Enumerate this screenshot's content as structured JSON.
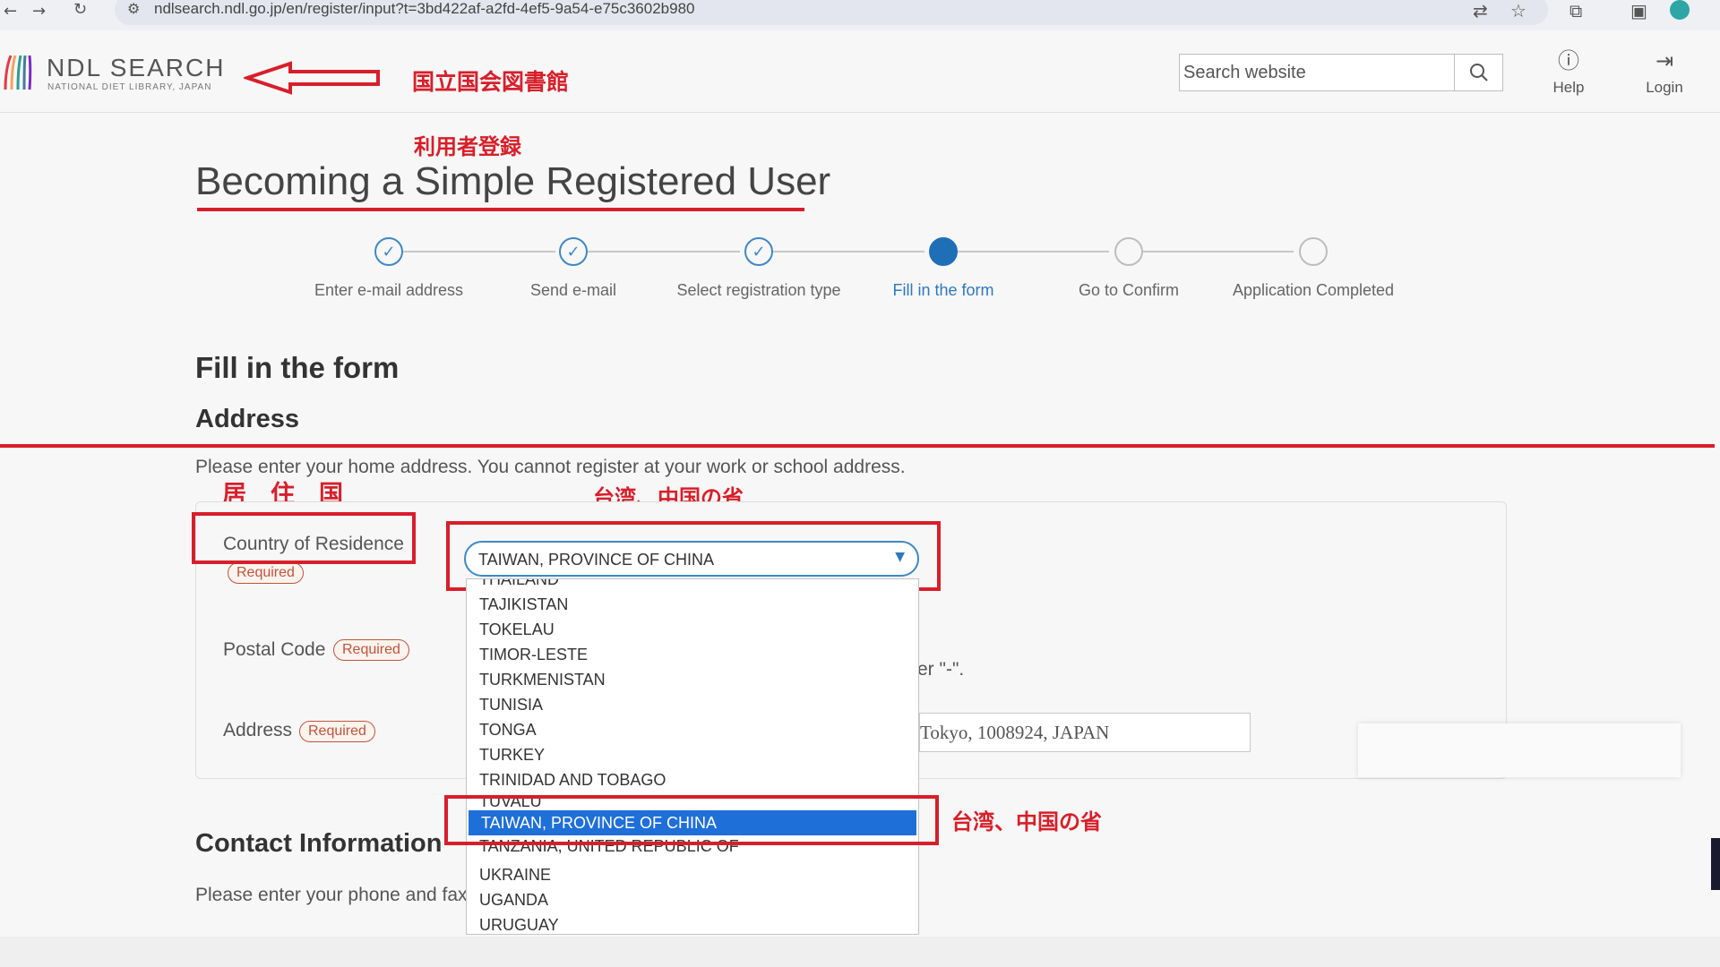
{
  "browser": {
    "url": "ndlsearch.ndl.go.jp/en/register/input?t=3bd422af-a2fd-4ef5-9a54-e75c3602b980",
    "back_icon": "arrow-left-icon",
    "forward_icon": "arrow-right-icon",
    "reload_icon": "reload-icon"
  },
  "header": {
    "logo_title": "NDL SEARCH",
    "logo_subtitle": "NATIONAL DIET LIBRARY, JAPAN",
    "search_placeholder": "Search website",
    "help_label": "Help",
    "login_label": "Login"
  },
  "annotations": {
    "library_name": "国立国会図書館",
    "user_registration": "利用者登録",
    "country_of_residence_jp": "居　住　国",
    "taiwan_province_top": "台湾、中国の省",
    "taiwan_province_side": "台湾、中国の省",
    "accent_color": "#d71f2a"
  },
  "page": {
    "title": "Becoming a Simple Registered User",
    "section_title": "Fill in the form",
    "address_heading": "Address",
    "address_help": "Please enter your home address. You cannot register at your work or school address.",
    "contact_heading": "Contact Information",
    "contact_help": "Please enter your phone and fax"
  },
  "steps": [
    {
      "label": "Enter e-mail address",
      "state": "done"
    },
    {
      "label": "Send e-mail",
      "state": "done"
    },
    {
      "label": "Select registration type",
      "state": "done"
    },
    {
      "label": "Fill in the form",
      "state": "current"
    },
    {
      "label": "Go to Confirm",
      "state": "todo"
    },
    {
      "label": "Application Completed",
      "state": "todo"
    }
  ],
  "form": {
    "country_label": "Country of Residence",
    "postal_label": "Postal Code",
    "address_label": "Address",
    "required_badge": "Required",
    "country_value": "TAIWAN, PROVINCE OF CHINA",
    "postal_hint_fragment": "er \"-\".",
    "address_value": "Tokyo, 1008924, JAPAN"
  },
  "dropdown": {
    "options": [
      "THAILAND",
      "TAJIKISTAN",
      "TOKELAU",
      "TIMOR-LESTE",
      "TURKMENISTAN",
      "TUNISIA",
      "TONGA",
      "TURKEY",
      "TRINIDAD AND TOBAGO",
      "TUVALU",
      "TAIWAN, PROVINCE OF CHINA",
      "TANZANIA, UNITED REPUBLIC OF",
      "UKRAINE",
      "UGANDA",
      "URUGUAY"
    ],
    "selected": "TAIWAN, PROVINCE OF CHINA",
    "highlight_color": "#1f6fd8"
  }
}
